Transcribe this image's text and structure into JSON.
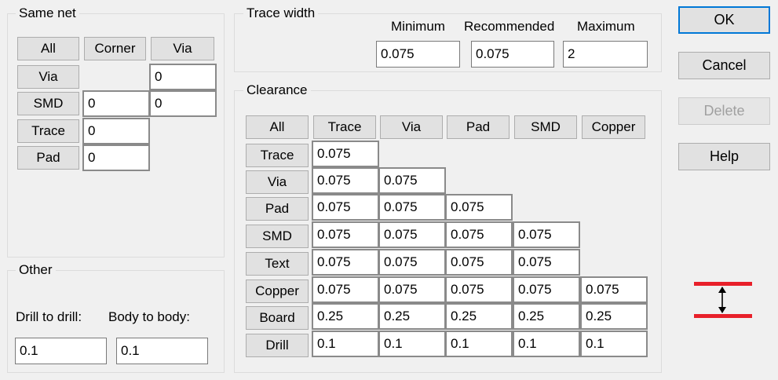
{
  "same_net": {
    "title": "Same net",
    "headers": [
      "All",
      "Corner",
      "Via"
    ],
    "row_labels": [
      "Via",
      "SMD",
      "Trace",
      "Pad"
    ],
    "values": {
      "via_via": "0",
      "smd_corner": "0",
      "smd_via": "0",
      "trace_corner": "0",
      "pad_corner": "0"
    }
  },
  "other": {
    "title": "Other",
    "drill_label": "Drill to drill:",
    "body_label": "Body to body:",
    "drill_value": "0.1",
    "body_value": "0.1"
  },
  "trace_width": {
    "title": "Trace width",
    "min_label": "Minimum",
    "rec_label": "Recommended",
    "max_label": "Maximum",
    "min_value": "0.075",
    "rec_value": "0.075",
    "max_value": "2"
  },
  "clearance": {
    "title": "Clearance",
    "col_headers": [
      "All",
      "Trace",
      "Via",
      "Pad",
      "SMD",
      "Copper"
    ],
    "row_labels": [
      "Trace",
      "Via",
      "Pad",
      "SMD",
      "Text",
      "Copper",
      "Board",
      "Drill"
    ],
    "rows": [
      [
        "0.075"
      ],
      [
        "0.075",
        "0.075"
      ],
      [
        "0.075",
        "0.075",
        "0.075"
      ],
      [
        "0.075",
        "0.075",
        "0.075",
        "0.075"
      ],
      [
        "0.075",
        "0.075",
        "0.075",
        "0.075"
      ],
      [
        "0.075",
        "0.075",
        "0.075",
        "0.075",
        "0.075"
      ],
      [
        "0.25",
        "0.25",
        "0.25",
        "0.25",
        "0.25"
      ],
      [
        "0.1",
        "0.1",
        "0.1",
        "0.1",
        "0.1"
      ]
    ]
  },
  "buttons": {
    "ok": "OK",
    "cancel": "Cancel",
    "delete": "Delete",
    "help": "Help"
  },
  "colors": {
    "clearance_icon_red": "#e8202a",
    "default_button_border": "#0078d7"
  },
  "icons": {
    "clearance_illustration": "clearance-gap-icon"
  }
}
